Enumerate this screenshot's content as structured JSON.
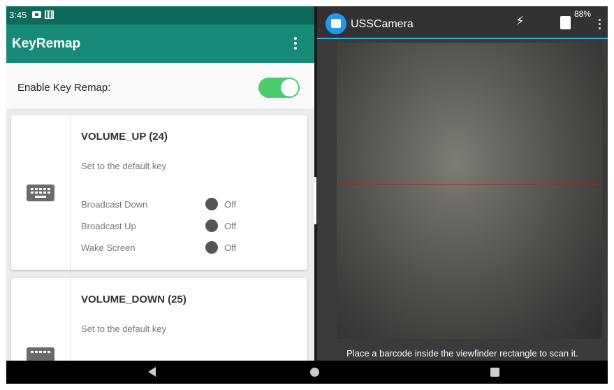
{
  "status_bar": {
    "time": "3:45"
  },
  "keyremap": {
    "title": "KeyRemap",
    "enable_label": "Enable Key Remap:",
    "enable_on": true,
    "cards": [
      {
        "key_name": "VOLUME_UP (24)",
        "description": "Set to the default key",
        "options": [
          {
            "label": "Broadcast Down",
            "value": "Off"
          },
          {
            "label": "Broadcast Up",
            "value": "Off"
          },
          {
            "label": "Wake Screen",
            "value": "Off"
          }
        ]
      },
      {
        "key_name": "VOLUME_DOWN (25)",
        "description": "Set to the default key"
      }
    ]
  },
  "camera": {
    "app_name": "USSCamera",
    "battery": "88%",
    "hint": "Place a barcode inside the viewfinder rectangle to scan it.",
    "scanline_color": "#c01818",
    "accent": "#3fb8e8"
  },
  "colors": {
    "toolbar": "#178a78",
    "statusbar": "#0b6a5c",
    "switch_on": "#4ccb6c"
  },
  "icons": {
    "app_menu": "overflow-menu-icon",
    "key": "keyboard-icon",
    "flash": "flash-off-icon",
    "nav_back": "back-icon",
    "nav_home": "home-icon",
    "nav_recent": "recents-icon"
  }
}
